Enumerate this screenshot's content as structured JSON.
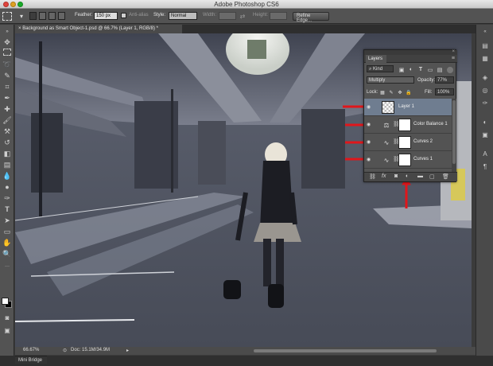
{
  "app": {
    "title": "Adobe Photoshop CS6"
  },
  "options": {
    "feather_label": "Feather:",
    "feather_value": "150 px",
    "antialias_label": "Anti-alias",
    "style_label": "Style:",
    "style_value": "Normal",
    "width_label": "Width:",
    "height_label": "Height:",
    "refine_label": "Refine Edge..."
  },
  "document": {
    "tab_close": "×",
    "tab_label": "Background as Smart Object-1.psd @ 66.7% (Layer 1, RGB/8) *"
  },
  "status": {
    "zoom": "66.67%",
    "doc": "Doc: 15.1M/34.9M"
  },
  "mini_bridge": {
    "label": "Mini Bridge"
  },
  "layers_panel": {
    "close": "×",
    "tab": "Layers",
    "menu": "≡",
    "filter_kind": "Kind",
    "blend_mode": "Multiply",
    "opacity_label": "Opacity:",
    "opacity_value": "77%",
    "lock_label": "Lock:",
    "fill_label": "Fill:",
    "fill_value": "100%",
    "layers": [
      {
        "name": "Layer 1",
        "selected": true
      },
      {
        "name": "Color Balance 1",
        "selected": false
      },
      {
        "name": "Curves 2",
        "selected": false
      },
      {
        "name": "Curves 1",
        "selected": false
      }
    ]
  },
  "colors": {
    "annotation_arrow": "#e0161b",
    "selection": "#6f7d90"
  }
}
